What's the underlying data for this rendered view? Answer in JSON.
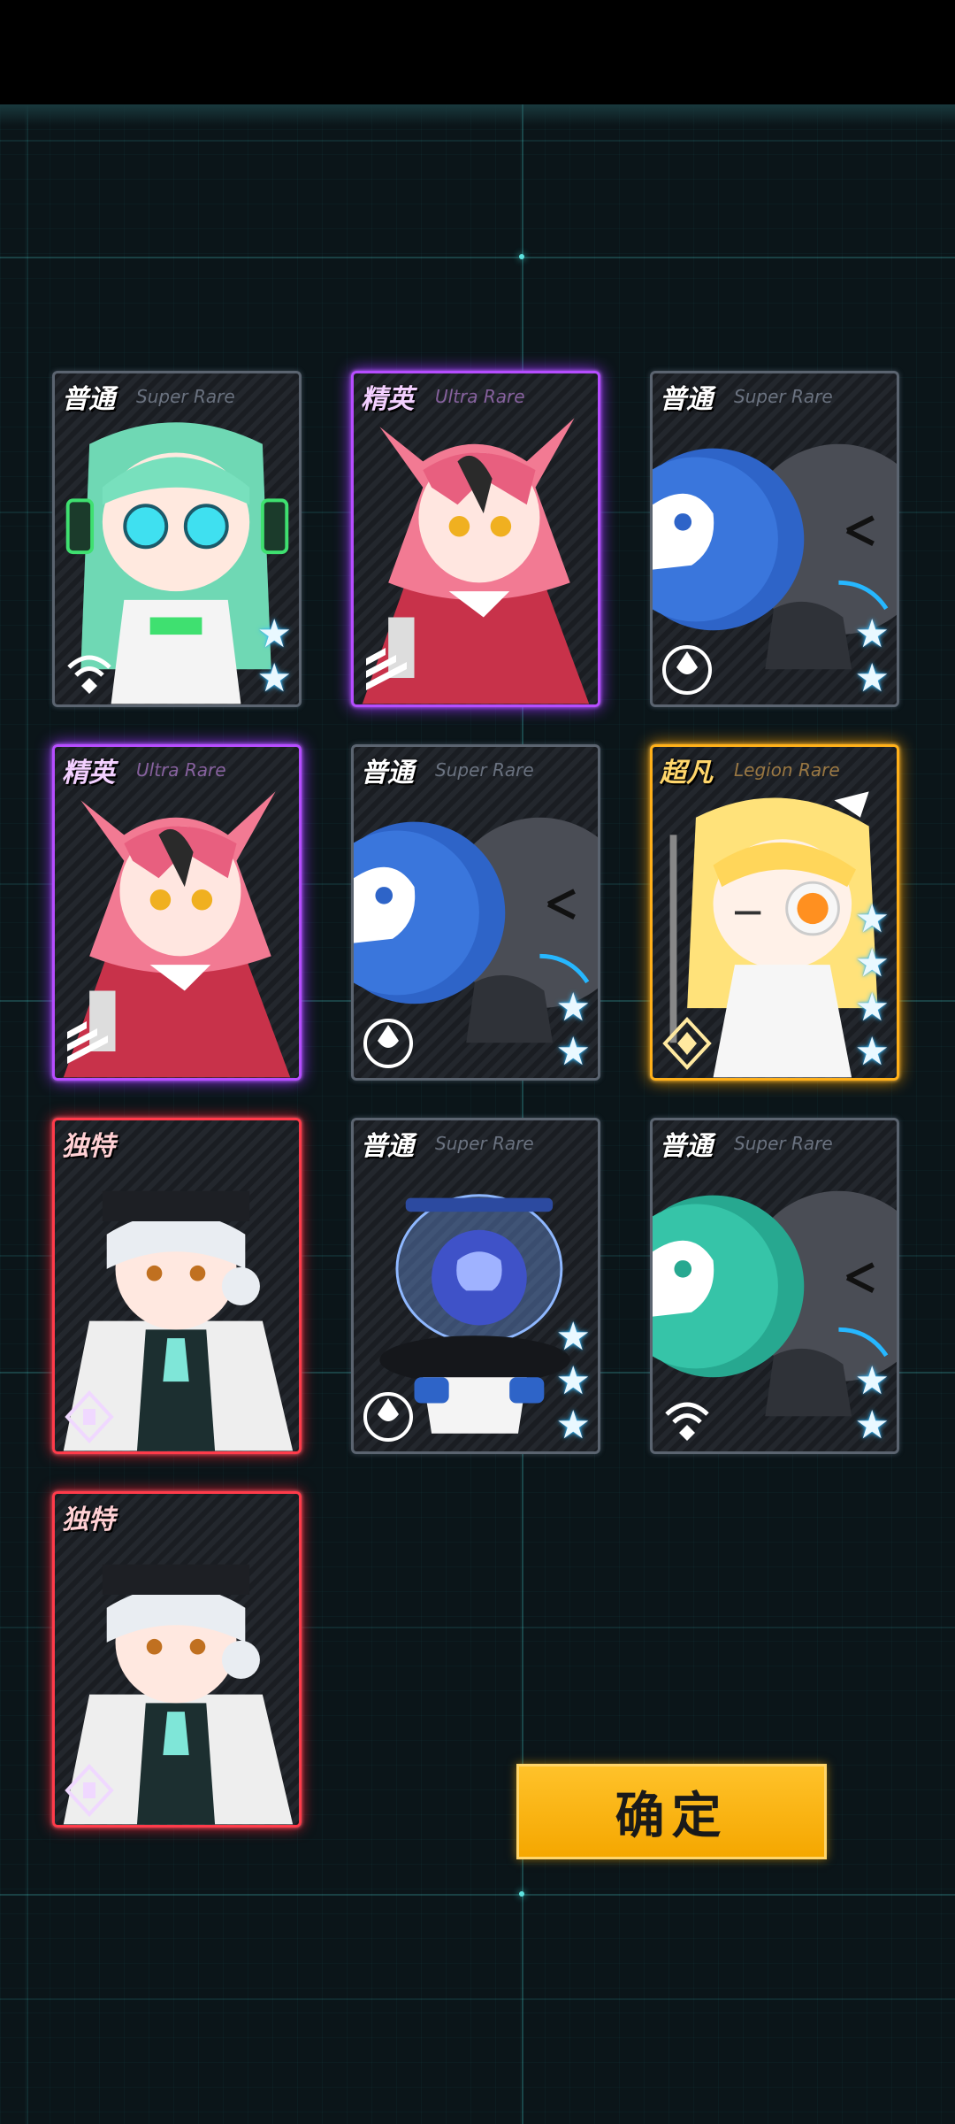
{
  "cards": [
    {
      "rarity": "普通",
      "rarity_en": "Super Rare",
      "tier": "common",
      "stars": 2,
      "class_icon": "signal-icon"
    },
    {
      "rarity": "精英",
      "rarity_en": "Ultra Rare",
      "tier": "elite",
      "stars": 0,
      "class_icon": "stripes-icon"
    },
    {
      "rarity": "普通",
      "rarity_en": "Super Rare",
      "tier": "common",
      "stars": 2,
      "class_icon": "drop-icon"
    },
    {
      "rarity": "精英",
      "rarity_en": "Ultra Rare",
      "tier": "elite",
      "stars": 0,
      "class_icon": "stripes-icon"
    },
    {
      "rarity": "普通",
      "rarity_en": "Super Rare",
      "tier": "common",
      "stars": 2,
      "class_icon": "drop-icon"
    },
    {
      "rarity": "超凡",
      "rarity_en": "Legion Rare",
      "tier": "super",
      "stars": 4,
      "class_icon": "diamond-icon"
    },
    {
      "rarity": "独特",
      "rarity_en": "",
      "tier": "unique",
      "stars": 0,
      "class_icon": "cross-diamond-icon"
    },
    {
      "rarity": "普通",
      "rarity_en": "Super Rare",
      "tier": "common",
      "stars": 3,
      "class_icon": "drop-icon"
    },
    {
      "rarity": "普通",
      "rarity_en": "Super Rare",
      "tier": "common",
      "stars": 2,
      "class_icon": "signal-icon"
    },
    {
      "rarity": "独特",
      "rarity_en": "",
      "tier": "unique",
      "stars": 0,
      "class_icon": "cross-diamond-icon"
    }
  ],
  "confirm_label": "确定",
  "colors": {
    "elite": "#b64dff",
    "super": "#ffb01a",
    "unique": "#ff3b4a",
    "common_border": "#5b6470",
    "button": "#f5a700",
    "grid": "#3cc8c8"
  }
}
